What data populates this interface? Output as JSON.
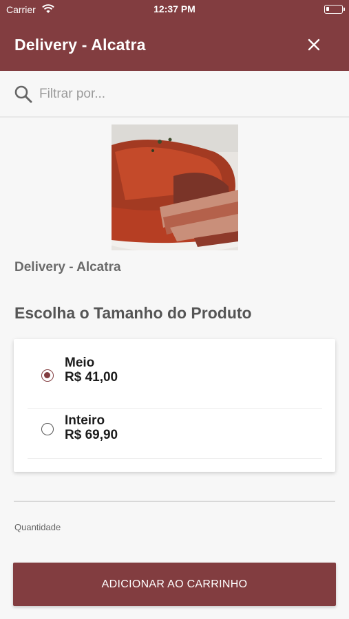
{
  "status_bar": {
    "carrier": "Carrier",
    "time": "12:37 PM"
  },
  "header": {
    "title": "Delivery - Alcatra",
    "close_icon": "close-icon"
  },
  "search": {
    "placeholder": "Filtrar por...",
    "value": "",
    "icon": "search-icon"
  },
  "product": {
    "name": "Delivery - Alcatra",
    "image": "roast-beef-photo"
  },
  "size_section": {
    "title": "Escolha o Tamanho do Produto",
    "options": [
      {
        "label": "Meio",
        "price": "R$ 41,00",
        "selected": true
      },
      {
        "label": "Inteiro",
        "price": "R$ 69,90",
        "selected": false
      }
    ]
  },
  "quantity": {
    "label": "Quantidade"
  },
  "actions": {
    "add_to_cart_label": "ADICIONAR AO CARRINHO"
  },
  "colors": {
    "brand": "#823d40",
    "background": "#f7f7f7"
  }
}
